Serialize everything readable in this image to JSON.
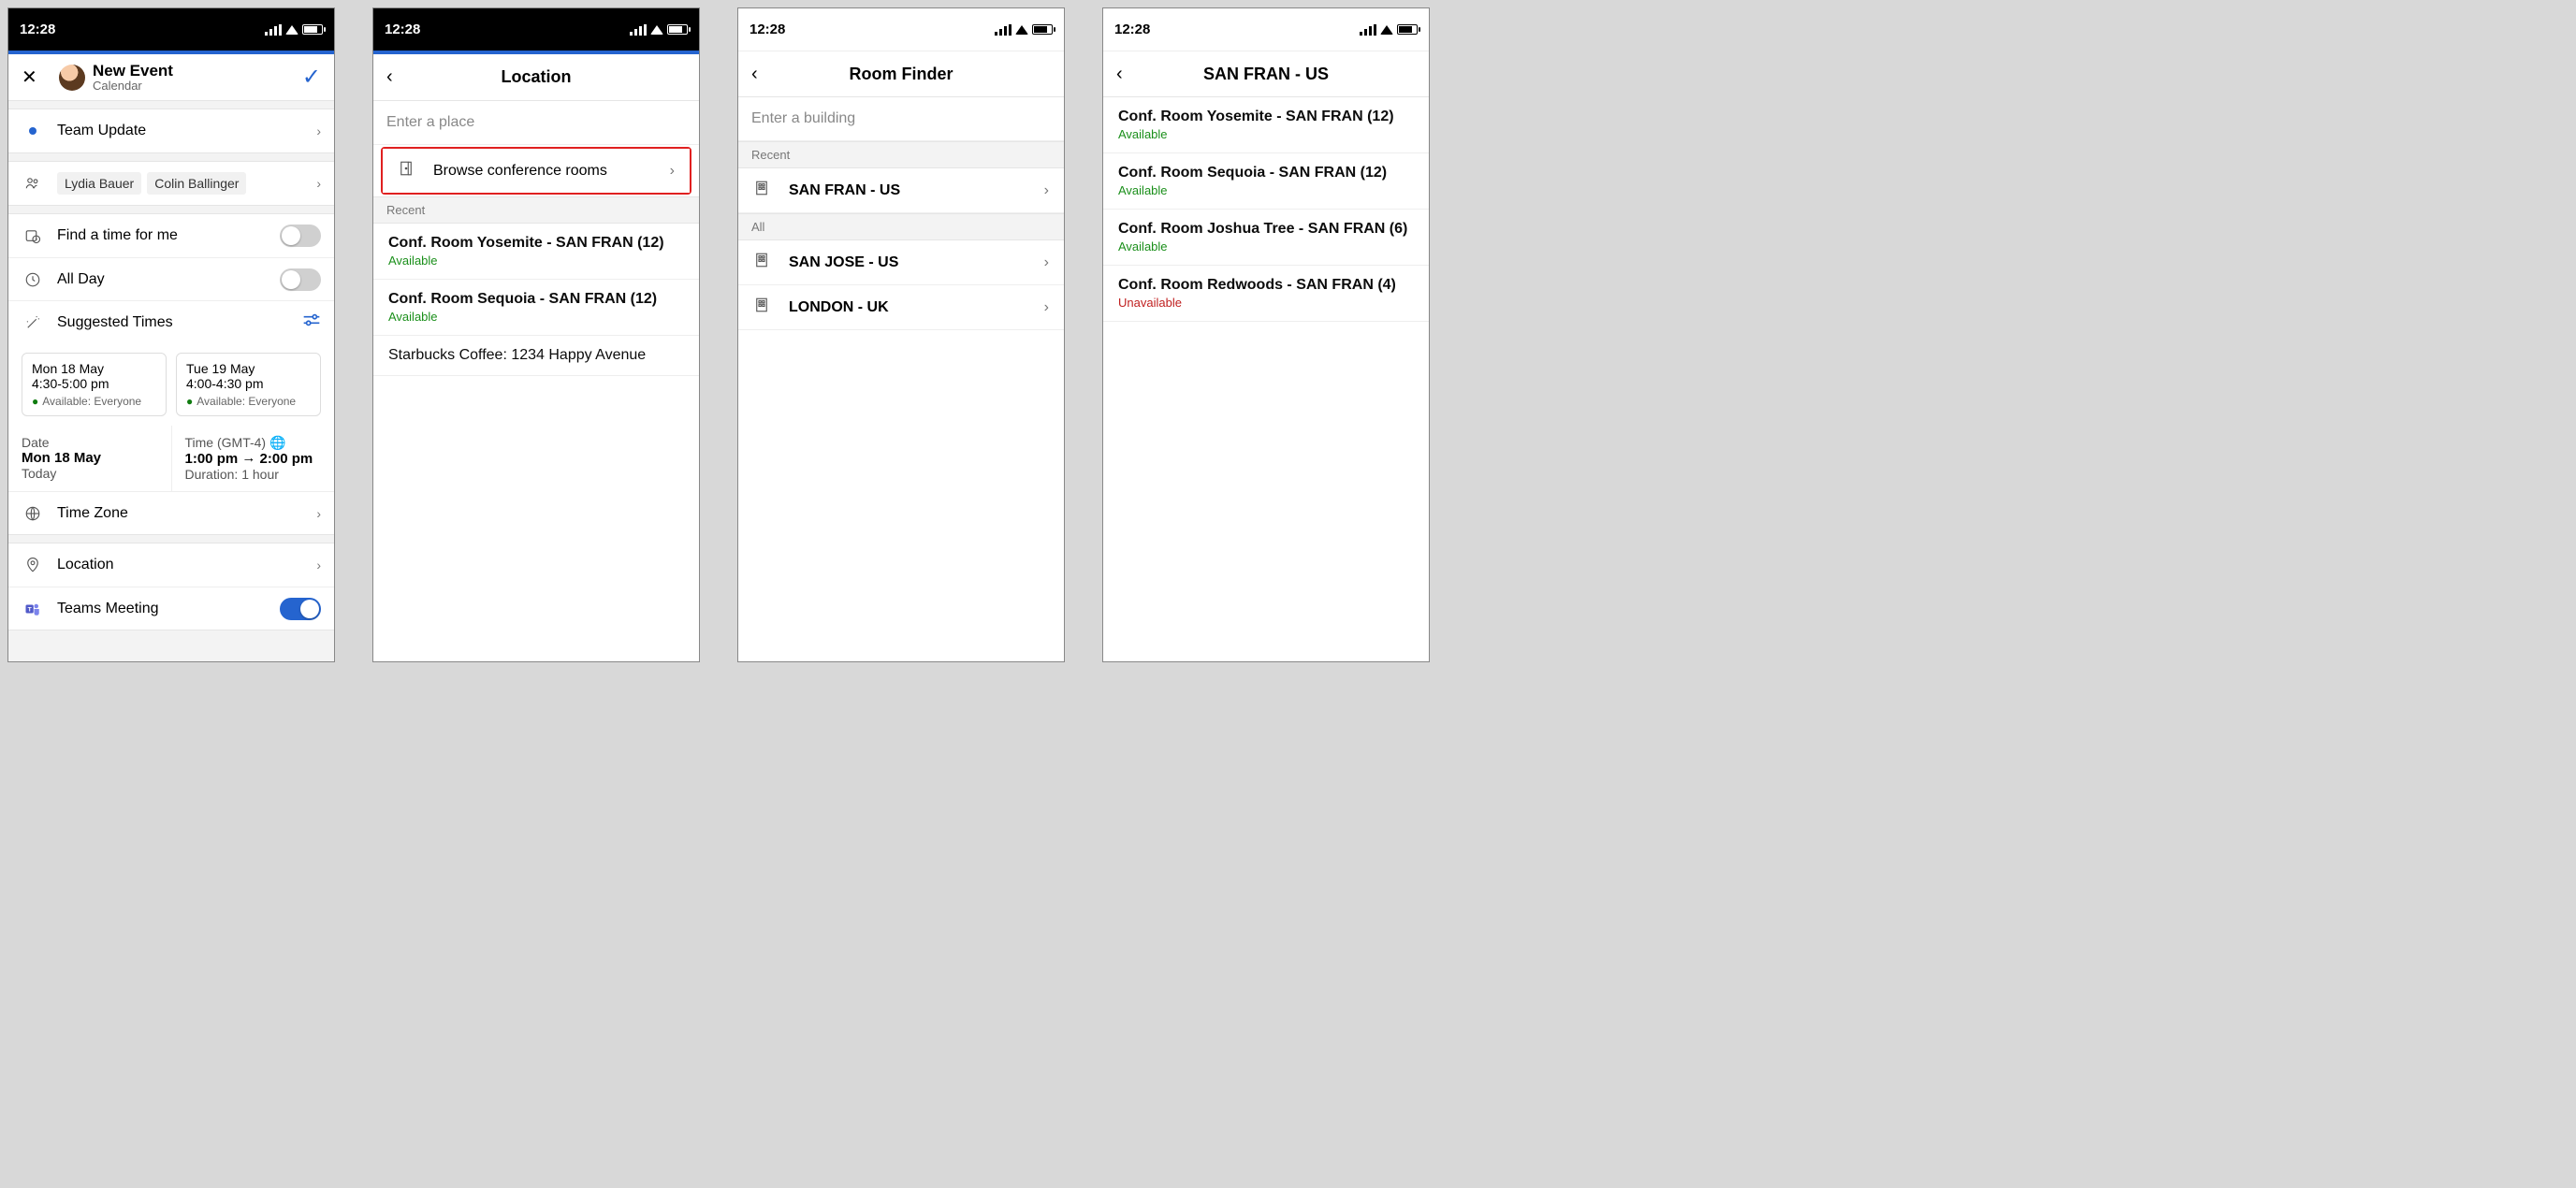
{
  "status": {
    "time": "12:28"
  },
  "pane1": {
    "header": {
      "title": "New Event",
      "subtitle": "Calendar"
    },
    "title_row": "Team Update",
    "attendees": [
      "Lydia Bauer",
      "Colin Ballinger"
    ],
    "findtime": "Find a time for me",
    "allday": "All Day",
    "suggested_label": "Suggested Times",
    "suggestions": [
      {
        "date": "Mon 18 May",
        "time": "4:30-5:00 pm",
        "avail": "Available: Everyone"
      },
      {
        "date": "Tue 19 May",
        "time": "4:00-4:30 pm",
        "avail": "Available: Everyone"
      }
    ],
    "date_label": "Date",
    "date_value": "Mon 18 May",
    "date_rel": "Today",
    "time_label": "Time (GMT-4)",
    "time_start": "1:00 pm",
    "time_end": "2:00 pm",
    "duration": "Duration: 1 hour",
    "timezone": "Time Zone",
    "location": "Location",
    "teams": "Teams Meeting"
  },
  "pane2": {
    "title": "Location",
    "placeholder": "Enter a place",
    "browse": "Browse conference rooms",
    "recent_label": "Recent",
    "recent": [
      {
        "name": "Conf. Room Yosemite - SAN FRAN (12)",
        "status": "Available",
        "status_class": "available"
      },
      {
        "name": "Conf. Room Sequoia - SAN FRAN (12)",
        "status": "Available",
        "status_class": "available"
      },
      {
        "name": "Starbucks Coffee: 1234 Happy Avenue",
        "status": "",
        "status_class": ""
      }
    ]
  },
  "pane3": {
    "title": "Room Finder",
    "placeholder": "Enter a building",
    "recent_label": "Recent",
    "recent": [
      {
        "name": "SAN FRAN - US"
      }
    ],
    "all_label": "All",
    "all": [
      {
        "name": "SAN JOSE - US"
      },
      {
        "name": "LONDON - UK"
      }
    ]
  },
  "pane4": {
    "title": "SAN FRAN - US",
    "rooms": [
      {
        "name": "Conf. Room Yosemite - SAN FRAN (12)",
        "status": "Available",
        "status_class": "available"
      },
      {
        "name": "Conf. Room Sequoia - SAN FRAN (12)",
        "status": "Available",
        "status_class": "available"
      },
      {
        "name": "Conf. Room Joshua Tree - SAN FRAN (6)",
        "status": "Available",
        "status_class": "available"
      },
      {
        "name": "Conf. Room Redwoods - SAN FRAN (4)",
        "status": "Unavailable",
        "status_class": "unavailable"
      }
    ]
  }
}
